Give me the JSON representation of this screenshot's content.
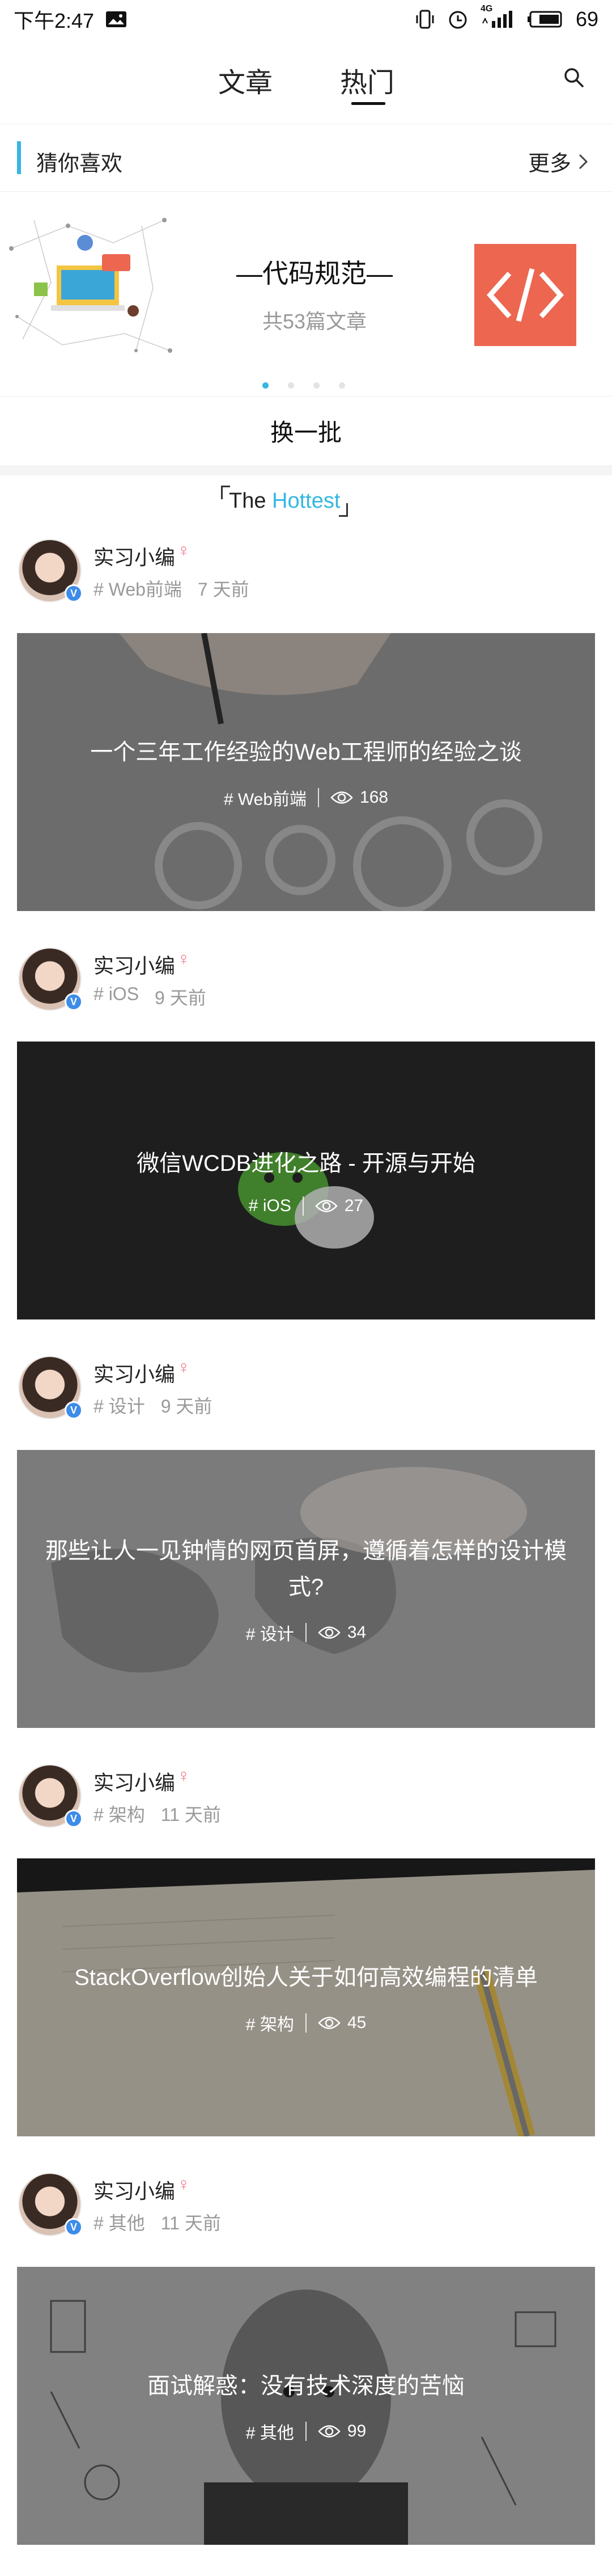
{
  "status_bar": {
    "time": "下午2:47",
    "network": "4G",
    "battery": "69"
  },
  "nav": {
    "tabs": [
      "文章",
      "热门"
    ],
    "active_tab": "热门"
  },
  "guess": {
    "title": "猜你喜欢",
    "more_label": "更多",
    "featured": {
      "title": "—代码规范—",
      "count": "共53篇文章"
    },
    "refresh_label": "换一批"
  },
  "hottest": {
    "prefix": "The",
    "highlight": "Hottest"
  },
  "colors": {
    "accent": "#34b7e0",
    "featured_thumb": "#ec6650",
    "verified": "#3d8ce8"
  },
  "posts": [
    {
      "author": "实习小编",
      "tag": "# Web前端",
      "time": "7 天前",
      "title": "一个三年工作经验的Web工程师的经验之谈",
      "views": "168"
    },
    {
      "author": "实习小编",
      "tag": "# iOS",
      "time": "9 天前",
      "title": "微信WCDB进化之路 - 开源与开始",
      "views": "27"
    },
    {
      "author": "实习小编",
      "tag": "# 设计",
      "time": "9 天前",
      "title": "那些让人一见钟情的网页首屏，遵循着怎样的设计模式?",
      "views": "34"
    },
    {
      "author": "实习小编",
      "tag": "# 架构",
      "time": "11 天前",
      "title": "StackOverflow创始人关于如何高效编程的清单",
      "views": "45"
    },
    {
      "author": "实习小编",
      "tag": "# 其他",
      "time": "11 天前",
      "title": "面试解惑：没有技术深度的苦恼",
      "views": "99"
    }
  ]
}
